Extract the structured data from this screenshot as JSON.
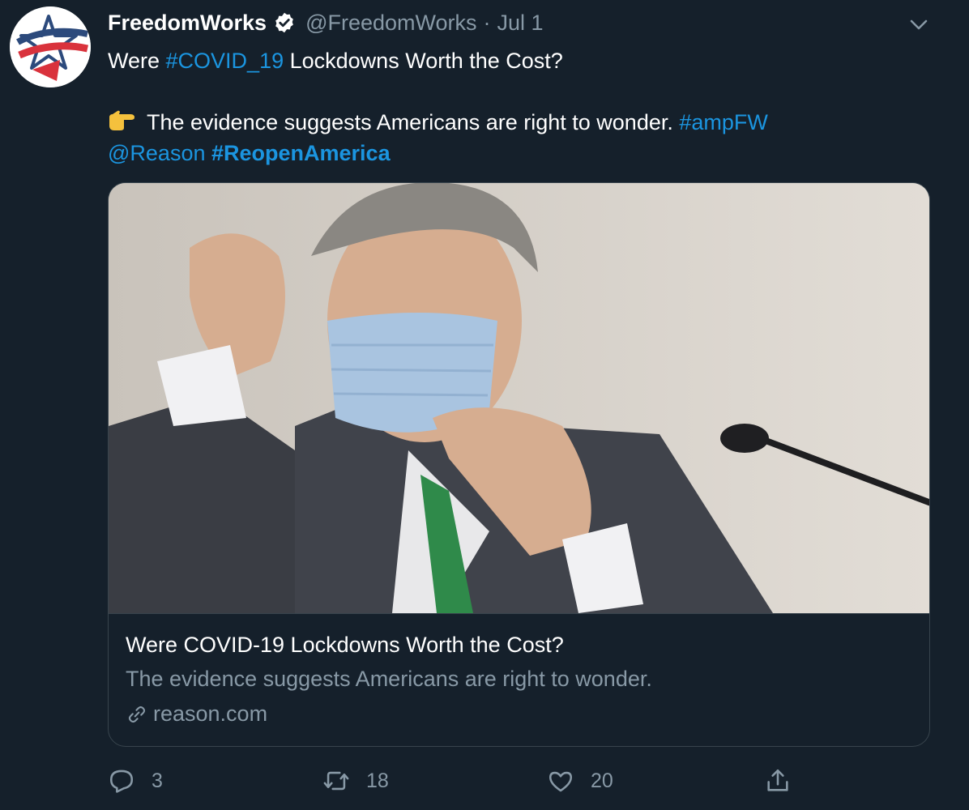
{
  "tweet": {
    "display_name": "FreedomWorks",
    "handle": "@FreedomWorks",
    "separator": "·",
    "date": "Jul 1",
    "text": {
      "line1_prefix": "Were ",
      "line1_hashtag": "#COVID_19",
      "line1_suffix": " Lockdowns Worth the Cost?",
      "line2_text": "The evidence suggests Americans are right to wonder. ",
      "line2_hashtag": "#ampFW",
      "line3_mention": "@Reason",
      "line3_hashtag": "#ReopenAmerica"
    },
    "card": {
      "title": "Were COVID-19 Lockdowns Worth the Cost?",
      "description": "The evidence suggests Americans are right to wonder.",
      "domain": "reason.com"
    },
    "actions": {
      "replies": "3",
      "retweets": "18",
      "likes": "20"
    }
  },
  "icons": {
    "avatar": "freedomworks-star-logo",
    "verified": "verified-badge-icon",
    "caret": "chevron-down-icon",
    "emoji": "backhand-index-pointing-right-emoji",
    "link": "link-icon",
    "reply": "reply-icon",
    "retweet": "retweet-icon",
    "like": "heart-icon",
    "share": "share-icon"
  },
  "colors": {
    "background": "#15202b",
    "link": "#1b95e0",
    "secondary_text": "#8899a6",
    "border": "#38444d"
  }
}
